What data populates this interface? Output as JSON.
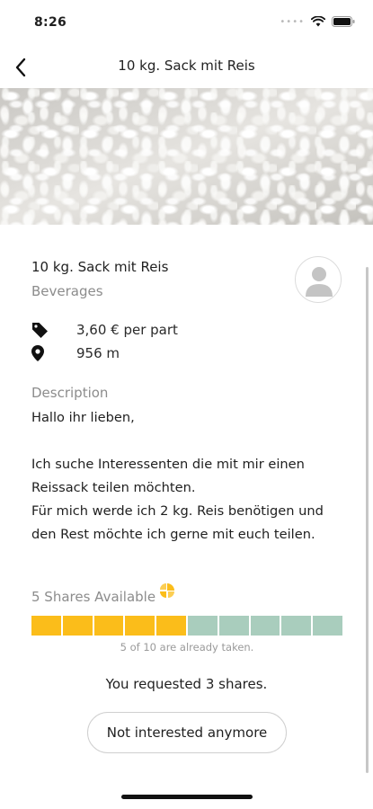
{
  "status_bar": {
    "time": "8:26"
  },
  "header": {
    "title": "10 kg. Sack mit Reis",
    "back_icon": "chevron-left-icon"
  },
  "hero_image": {
    "subject": "rice grains"
  },
  "offer": {
    "title": "10 kg. Sack mit Reis",
    "category": "Beverages",
    "price": "3,60 € per part",
    "distance": "956 m"
  },
  "description": {
    "label": "Description",
    "text": "Hallo ihr lieben,\n\nIch suche Interessenten die mit mir einen Reissack teilen möchten.\nFür mich werde ich 2 kg. Reis benötigen und den Rest möchte ich gerne mit euch teilen."
  },
  "shares": {
    "label": "5 Shares Available",
    "total": 10,
    "taken": 5,
    "caption": "5 of 10 are already taken.",
    "colors": {
      "taken": "#fbbd1a",
      "free": "#a9cdbd"
    }
  },
  "request": {
    "status": "You requested 3 shares.",
    "button_label": "Not interested anymore"
  },
  "colors": {
    "accent": "#fbbd1a",
    "secondary": "#a9cdbd",
    "muted_text": "#8c8c8c"
  }
}
